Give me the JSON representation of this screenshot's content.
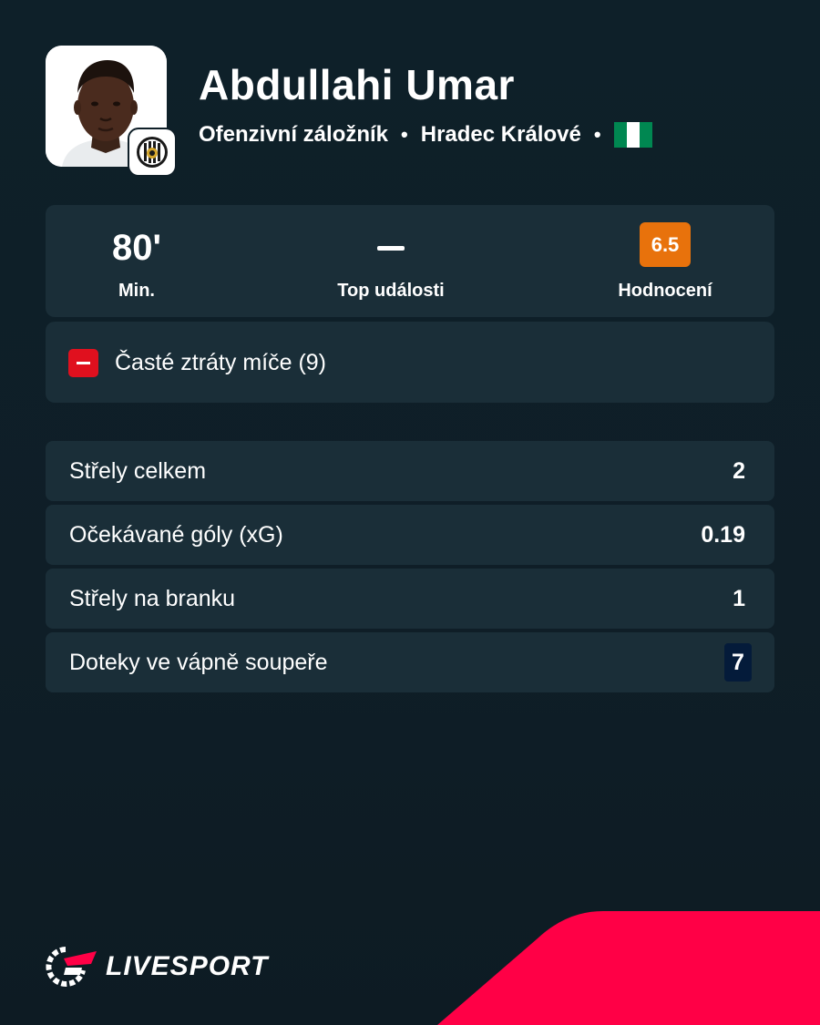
{
  "colors": {
    "background": "#0f1f28",
    "card": "#1a2e38",
    "rating": "#e8720c",
    "negative": "#e0101e",
    "highlight": "#041b3a",
    "brand": "#ff0046"
  },
  "player": {
    "name": "Abdullahi Umar",
    "position": "Ofenzivní záložník",
    "club": "Hradec Králové",
    "flag_icon": "nigeria-flag",
    "separator": "•"
  },
  "summary": {
    "minutes": "80'",
    "minutes_label": "Min.",
    "top_events_label": "Top události",
    "rating": "6.5",
    "rating_label": "Hodnocení"
  },
  "event": {
    "icon": "minus-icon",
    "text": "Časté ztráty míče (9)"
  },
  "stats": [
    {
      "label": "Střely celkem",
      "value": "2"
    },
    {
      "label": "Očekávané góly (xG)",
      "value": "0.19"
    },
    {
      "label": "Střely na branku",
      "value": "1"
    },
    {
      "label": "Doteky ve vápně soupeře",
      "value": "7",
      "highlighted": true
    }
  ],
  "brand": {
    "logo_text": "LIVESPORT",
    "logo_icon": "livesport-logo-icon"
  }
}
